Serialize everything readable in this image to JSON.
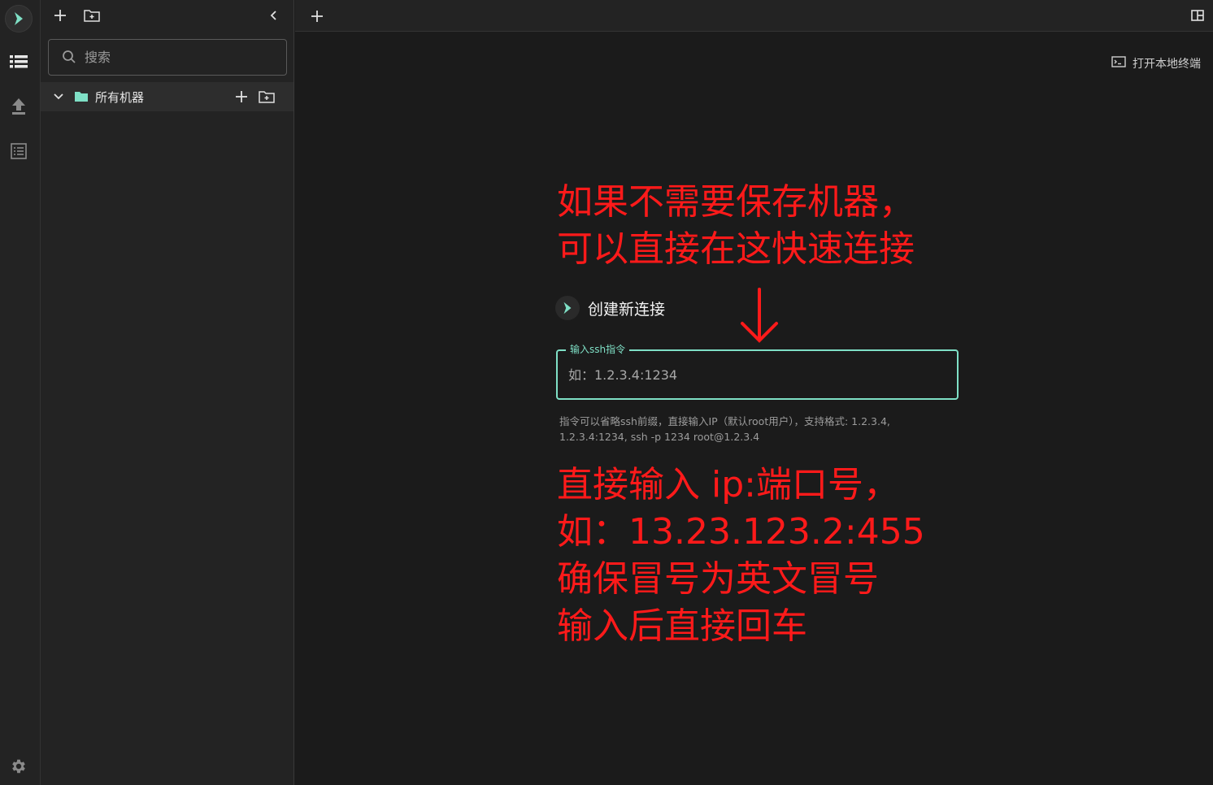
{
  "sidebar": {
    "search_placeholder": "搜索",
    "tree": {
      "root_label": "所有机器"
    }
  },
  "main": {
    "local_terminal_label": "打开本地终端",
    "new_connection_title": "创建新连接",
    "ssh_field": {
      "legend": "输入ssh指令",
      "placeholder": "如：1.2.3.4:1234"
    },
    "hint_line1": "指令可以省略ssh前缀，直接输入IP（默认root用户），支持格式: 1.2.3.4,",
    "hint_line2": "1.2.3.4:1234, ssh -p 1234 root@1.2.3.4"
  },
  "annotations": {
    "top_lines": [
      "如果不需要保存机器，",
      "可以直接在这快速连接"
    ],
    "bottom_lines": [
      "直接输入 ip:端口号，",
      "如：13.23.123.2:455",
      "确保冒号为英文冒号",
      "输入后直接回车"
    ],
    "color": "#ff1a1a"
  },
  "colors": {
    "accent": "#7fe0c6",
    "background": "#1b1b1b",
    "panel": "#232323"
  }
}
